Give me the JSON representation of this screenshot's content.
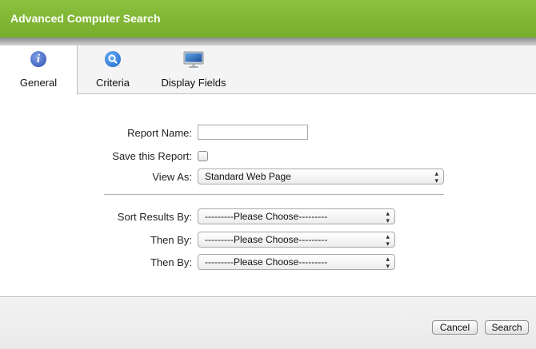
{
  "header": {
    "title": "Advanced Computer Search"
  },
  "tabs": [
    {
      "label": "General",
      "icon": "info-icon",
      "active": true
    },
    {
      "label": "Criteria",
      "icon": "search-icon",
      "active": false
    },
    {
      "label": "Display Fields",
      "icon": "monitor-icon",
      "active": false
    }
  ],
  "form": {
    "report_name_label": "Report Name:",
    "report_name_value": "",
    "save_report_label": "Save this Report:",
    "save_report_checked": false,
    "view_as_label": "View As:",
    "view_as_value": "Standard Web Page",
    "sort_results_label": "Sort Results By:",
    "sort_results_value": "---------Please Choose---------",
    "then_by_1_label": "Then By:",
    "then_by_1_value": "---------Please Choose---------",
    "then_by_2_label": "Then By:",
    "then_by_2_value": "---------Please Choose---------"
  },
  "footer": {
    "cancel_label": "Cancel",
    "search_label": "Search"
  },
  "colors": {
    "header_green": "#80b636",
    "tab_bar_bg": "#f4f4f4"
  }
}
